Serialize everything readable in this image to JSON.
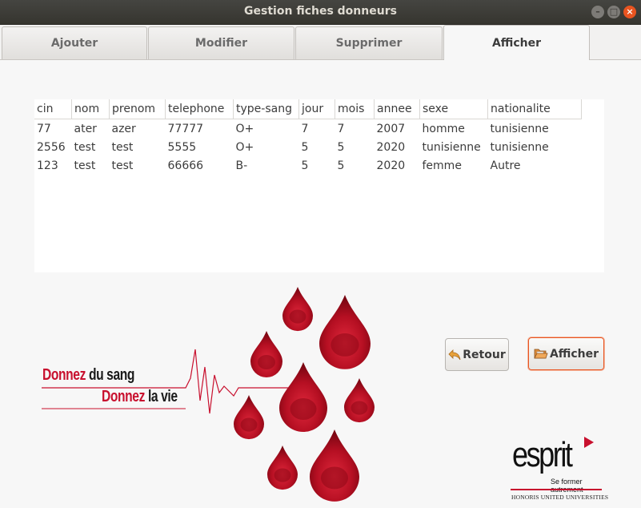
{
  "window": {
    "title": "Gestion fiches donneurs"
  },
  "tabs": [
    {
      "label": "Ajouter"
    },
    {
      "label": "Modifier"
    },
    {
      "label": "Supprimer"
    },
    {
      "label": "Afficher"
    }
  ],
  "table": {
    "columns": [
      "cin",
      "nom",
      "prenom",
      "telephone",
      "type-sang",
      "jour",
      "mois",
      "annee",
      "sexe",
      "nationalite"
    ],
    "rows": [
      [
        "77",
        "ater",
        "azer",
        "77777",
        "O+",
        "7",
        "7",
        "2007",
        "homme",
        "tunisienne"
      ],
      [
        "2556",
        "test",
        "test",
        "5555",
        "O+",
        "5",
        "5",
        "2020",
        "tunisienne",
        "tunisienne"
      ],
      [
        "123",
        "test",
        "test",
        "66666",
        "B-",
        "5",
        "5",
        "2020",
        "femme",
        "Autre"
      ]
    ]
  },
  "buttons": {
    "retour": "Retour",
    "afficher": "Afficher"
  },
  "slogan": {
    "line1_red": "Donnez",
    "line1_dark": "du sang",
    "line2_red": "Donnez",
    "line2_dark": "la vie"
  },
  "logo": {
    "name": "esprit",
    "tagline": "Se former autrement",
    "footer": "HONORIS UNITED UNIVERSITIES"
  },
  "colors": {
    "accent": "#e95420",
    "blood": "#c8102e"
  },
  "icons": [
    "close-icon",
    "minimize-icon",
    "maximize-icon",
    "back-arrow-icon",
    "folder-open-icon",
    "blood-drop-icon"
  ]
}
